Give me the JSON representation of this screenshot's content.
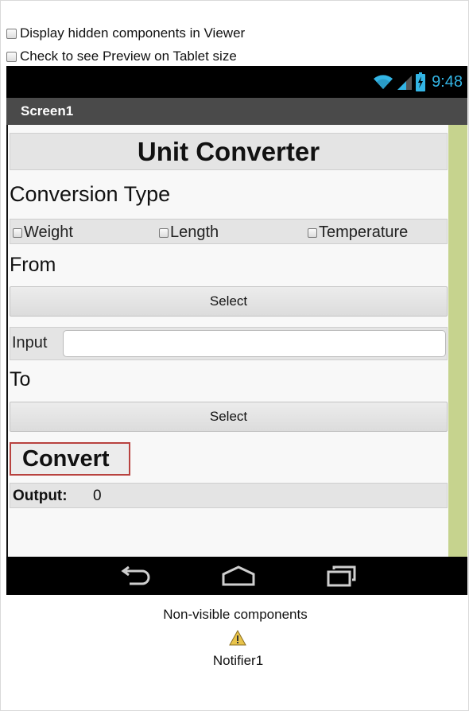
{
  "designer_options": {
    "display_hidden": "Display hidden components in Viewer",
    "tablet_preview": "Check to see Preview on Tablet size"
  },
  "status_bar": {
    "time": "9:48",
    "icons": [
      "wifi-icon",
      "signal-icon",
      "battery-icon"
    ]
  },
  "title_bar": {
    "title": "Screen1"
  },
  "screen": {
    "header": "Unit Converter",
    "conversion_type_label": "Conversion Type",
    "conversion_options": [
      "Weight",
      "Length",
      "Temperature"
    ],
    "from_label": "From",
    "from_select": "Select",
    "input_label": "Input",
    "input_value": "",
    "to_label": "To",
    "to_select": "Select",
    "convert_button": "Convert",
    "output_label": "Output:",
    "output_value": "0"
  },
  "nav_bar": {
    "buttons": [
      "back-icon",
      "home-icon",
      "recent-apps-icon"
    ]
  },
  "non_visible": {
    "title": "Non-visible components",
    "items": [
      {
        "label": "Notifier1",
        "icon": "warning-icon"
      }
    ]
  },
  "colors": {
    "clock": "#33b5e5",
    "title_bar": "#4a4a4a",
    "scroll_strip": "#c6d38e",
    "convert_border": "#b8423f"
  }
}
